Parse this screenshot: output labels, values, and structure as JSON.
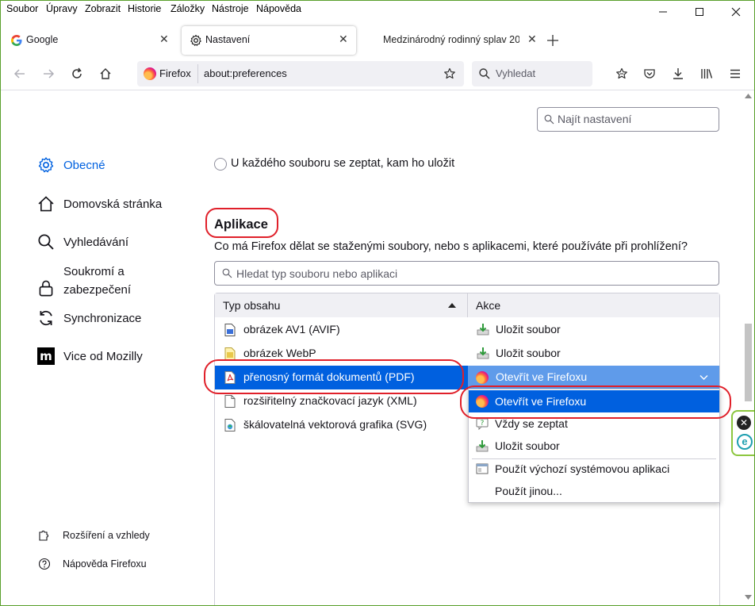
{
  "menu": [
    "Soubor",
    "Úpravy",
    "Zobrazit",
    "Historie",
    "Záložky",
    "Nástroje",
    "Nápověda"
  ],
  "tabs": [
    {
      "label": "Google",
      "icon": "google-g-icon"
    },
    {
      "label": "Nastavení",
      "icon": "gear-icon"
    },
    {
      "label": "Medzinárodný rodinný splav 20",
      "icon": ""
    }
  ],
  "urlbar": {
    "identity": "Firefox",
    "url": "about:preferences"
  },
  "searchbar": {
    "placeholder": "Vyhledat"
  },
  "sidebar": {
    "categories": [
      {
        "label": "Obecné",
        "icon": "gear-icon"
      },
      {
        "label": "Domovská stránka",
        "icon": "home-icon"
      },
      {
        "label": "Vyhledávání",
        "icon": "search-icon"
      },
      {
        "label": "Soukromí a zabezpečení",
        "icon": "lock-icon"
      },
      {
        "label": "Synchronizace",
        "icon": "sync-icon"
      },
      {
        "label": "Vice od Mozilly",
        "icon": "mozilla-m-icon"
      }
    ],
    "footer": [
      {
        "label": "Rozšíření a vzhledy",
        "icon": "puzzle-icon"
      },
      {
        "label": "Nápověda Firefoxu",
        "icon": "help-icon"
      }
    ]
  },
  "find": {
    "placeholder": "Najít nastavení"
  },
  "downloads": {
    "ask_label": "U každého souboru se zeptat, kam ho uložit"
  },
  "applications": {
    "heading": "Aplikace",
    "description": "Co má Firefox dělat se staženými soubory, nebo s aplikacemi, které používáte při prohlížení?",
    "filter_placeholder": "Hledat typ souboru nebo aplikaci",
    "col_type": "Typ obsahu",
    "col_action": "Akce",
    "rows": [
      {
        "type": "obrázek AV1 (AVIF)",
        "action": "Uložit soubor"
      },
      {
        "type": "obrázek WebP",
        "action": "Uložit soubor"
      },
      {
        "type": "přenosný formát dokumentů (PDF)",
        "action": "Otevřít ve Firefoxu"
      },
      {
        "type": "rozšiřitelný značkovací jazyk (XML)",
        "action": ""
      },
      {
        "type": "škálovatelná vektorová grafika (SVG)",
        "action": ""
      }
    ],
    "dropdown": [
      "Otevřít ve Firefoxu",
      "Vždy se zeptat",
      "Uložit soubor",
      "Použít výchozí systémovou aplikaci",
      "Použít jinou..."
    ]
  },
  "colors": {
    "accent": "#0061e0",
    "selected_row": "#0060df",
    "annotation": "#e0202a"
  }
}
